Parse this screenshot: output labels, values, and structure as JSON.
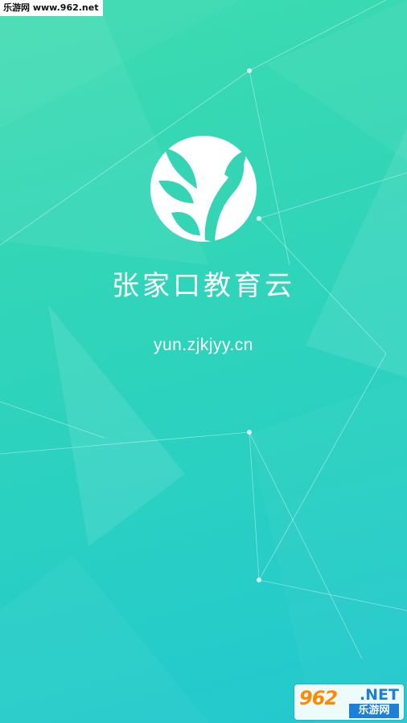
{
  "watermark": {
    "text": "乐游网 www.962.net"
  },
  "splash": {
    "app_name": "张家口教育云",
    "app_url": "yun.zjkjyy.cn",
    "logo_icon": "sprout-leaf-logo-icon",
    "background_colors": [
      "#3ddbb0",
      "#2bd1c0",
      "#22c8cf"
    ]
  },
  "badge": {
    "number": "962",
    "suffix": ".NET",
    "site_name": "乐游网",
    "accent_orange": "#ff8a00",
    "accent_blue": "#1d7fd6"
  }
}
